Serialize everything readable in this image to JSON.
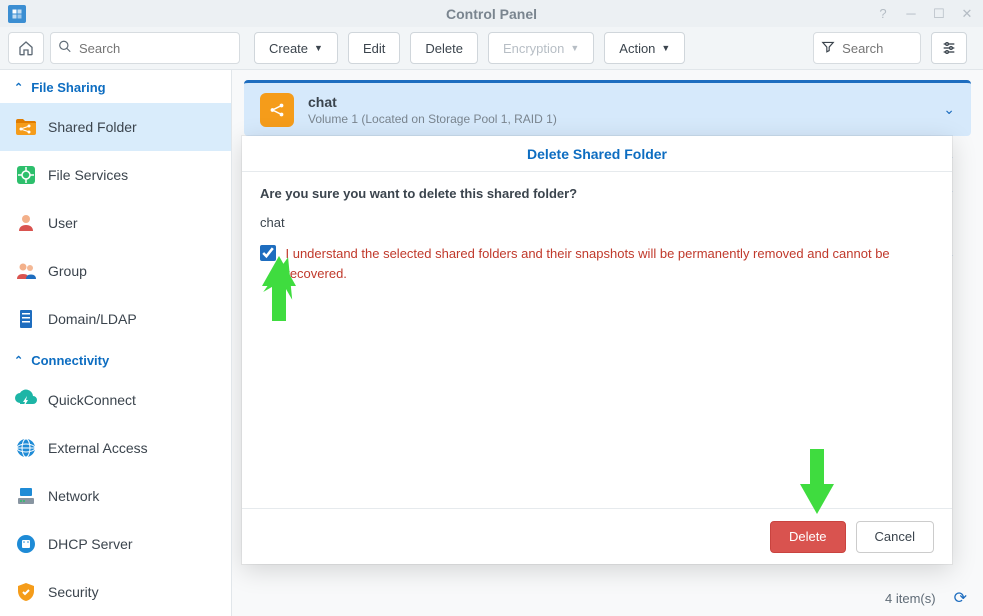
{
  "titlebar": {
    "title": "Control Panel"
  },
  "search": {
    "placeholder": "Search"
  },
  "toolbar": {
    "create": "Create",
    "edit": "Edit",
    "delete": "Delete",
    "encryption": "Encryption",
    "action": "Action",
    "search_placeholder": "Search"
  },
  "sidebar": {
    "sections": {
      "file_sharing": "File Sharing",
      "connectivity": "Connectivity"
    },
    "items": [
      {
        "id": "shared-folder",
        "label": "Shared Folder"
      },
      {
        "id": "file-services",
        "label": "File Services"
      },
      {
        "id": "user",
        "label": "User"
      },
      {
        "id": "group",
        "label": "Group"
      },
      {
        "id": "domain-ldap",
        "label": "Domain/LDAP"
      },
      {
        "id": "quickconnect",
        "label": "QuickConnect"
      },
      {
        "id": "external-access",
        "label": "External Access"
      },
      {
        "id": "network",
        "label": "Network"
      },
      {
        "id": "dhcp-server",
        "label": "DHCP Server"
      },
      {
        "id": "security",
        "label": "Security"
      }
    ]
  },
  "folder": {
    "name": "chat",
    "meta": "Volume 1 (Located on Storage Pool 1, RAID 1)"
  },
  "dialog": {
    "title": "Delete Shared Folder",
    "question": "Are you sure you want to delete this shared folder?",
    "item": "chat",
    "check_label": "I understand the selected shared folders and their snapshots will be permanently removed and cannot be recovered.",
    "delete": "Delete",
    "cancel": "Cancel"
  },
  "footer": {
    "count": "4 item(s)"
  }
}
